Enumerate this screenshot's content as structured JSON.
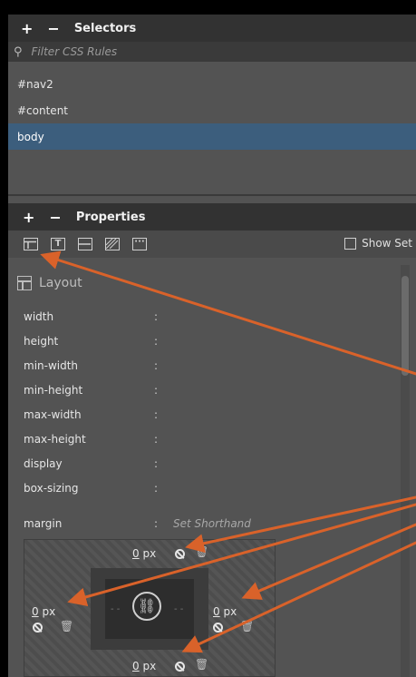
{
  "selectors": {
    "title": "Selectors",
    "add_symbol": "+",
    "remove_symbol": "−",
    "filter_placeholder": "Filter CSS Rules",
    "items": [
      {
        "label": "#nav2",
        "selected": false
      },
      {
        "label": "#content",
        "selected": false
      },
      {
        "label": "body",
        "selected": true
      }
    ]
  },
  "properties": {
    "title": "Properties",
    "add_symbol": "+",
    "remove_symbol": "−",
    "show_set_label": "Show Set",
    "layout_title": "Layout",
    "rows": [
      {
        "name": "width",
        "colon": ":"
      },
      {
        "name": "height",
        "colon": ":"
      },
      {
        "name": "min-width",
        "colon": ":"
      },
      {
        "name": "min-height",
        "colon": ":"
      },
      {
        "name": "max-width",
        "colon": ":"
      },
      {
        "name": "max-height",
        "colon": ":"
      },
      {
        "name": "display",
        "colon": ":"
      },
      {
        "name": "box-sizing",
        "colon": ":"
      }
    ],
    "margin": {
      "name": "margin",
      "colon": ":",
      "shorthand": "Set Shorthand",
      "top": {
        "value": "0",
        "unit": "px"
      },
      "left": {
        "value": "0",
        "unit": "px"
      },
      "right": {
        "value": "0",
        "unit": "px"
      },
      "bottom": {
        "value": "0",
        "unit": "px"
      }
    }
  },
  "icons": {
    "tools": [
      "layout-icon",
      "text-icon",
      "border-icon",
      "background-icon",
      "more-icon"
    ],
    "link": "link-icon",
    "clear": "disable-icon",
    "delete": "trash-icon"
  },
  "colors": {
    "panel_bg": "#535353",
    "header_bg": "#323232",
    "selected_bg": "#3c5e7d",
    "arrow": "#d9622a"
  }
}
